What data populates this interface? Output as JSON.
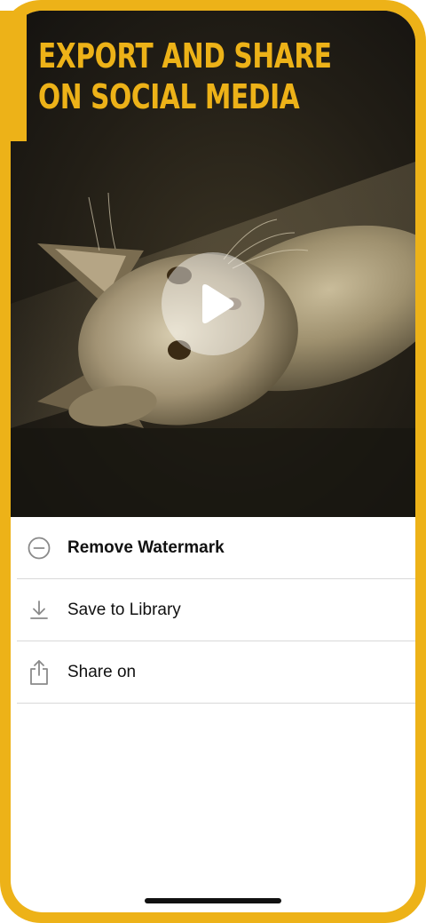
{
  "hero": {
    "title_line1": "EXPORT AND SHARE",
    "title_line2": "ON SOCIAL MEDIA",
    "play_icon": "play-icon",
    "accent_color": "#EDB218"
  },
  "menu": {
    "items": [
      {
        "label": "Remove Watermark",
        "icon": "minus-circle-icon",
        "bold": true
      },
      {
        "label": "Save to Library",
        "icon": "download-icon",
        "bold": false
      },
      {
        "label": "Share on",
        "icon": "share-icon",
        "bold": false
      }
    ]
  }
}
